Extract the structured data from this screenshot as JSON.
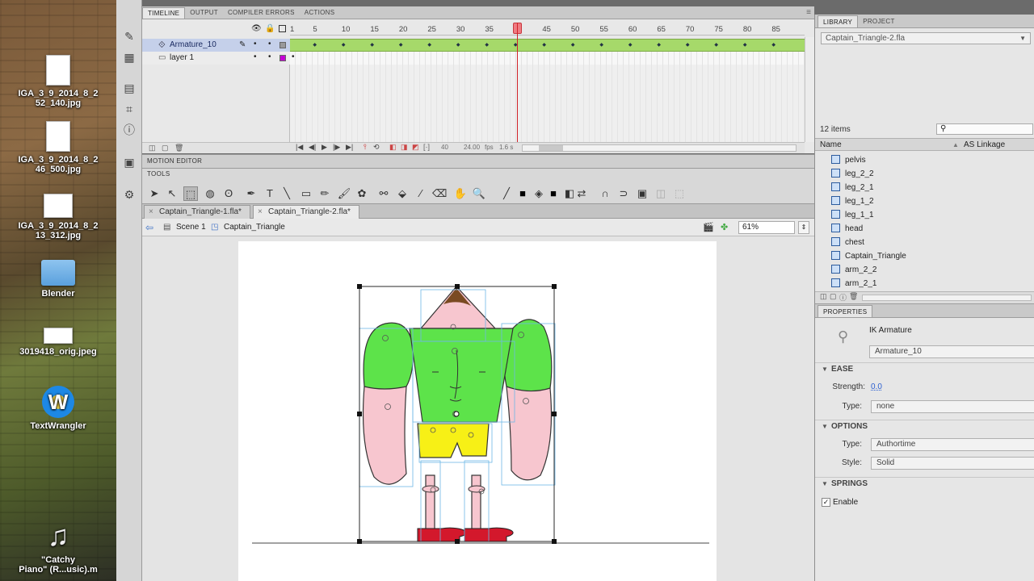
{
  "desktop": {
    "items": [
      {
        "label": "IGA_3_9_2014_8_2\n52_140.jpg"
      },
      {
        "label": "IGA_3_9_2014_8_2\n46_500.jpg"
      },
      {
        "label": "IGA_3_9_2014_8_2\n13_312.jpg"
      },
      {
        "label": "Blender"
      },
      {
        "label": "3019418_orig.jpeg"
      },
      {
        "label": "TextWrangler"
      },
      {
        "label": "\"Catchy\nPiano\" (R...usic).m"
      }
    ]
  },
  "timeline": {
    "tabs": [
      "TIMELINE",
      "OUTPUT",
      "COMPILER ERRORS",
      "ACTIONS"
    ],
    "frame_numbers": [
      "1",
      "5",
      "10",
      "15",
      "20",
      "25",
      "30",
      "35",
      "40",
      "45",
      "50",
      "55",
      "60",
      "65",
      "70",
      "75",
      "80",
      "85"
    ],
    "current_frame": 40,
    "layers": [
      {
        "name": "Armature_10",
        "selected": true
      },
      {
        "name": "layer 1",
        "selected": false
      }
    ],
    "footer": {
      "frame": "40",
      "fps": "24.00",
      "fps_unit": "fps",
      "time": "1.6 s"
    }
  },
  "motion_editor": {
    "label": "MOTION EDITOR"
  },
  "tools": {
    "label": "TOOLS"
  },
  "documents": {
    "tabs": [
      {
        "label": "Captain_Triangle-1.fla*",
        "active": false
      },
      {
        "label": "Captain_Triangle-2.fla*",
        "active": true
      }
    ]
  },
  "editbar": {
    "scene": "Scene 1",
    "symbol": "Captain_Triangle",
    "zoom": "61%"
  },
  "library": {
    "tabs": [
      "LIBRARY",
      "PROJECT"
    ],
    "document": "Captain_Triangle-2.fla",
    "count": "12 items",
    "columns": [
      "Name",
      "AS Linkage"
    ],
    "items": [
      "pelvis",
      "leg_2_2",
      "leg_2_1",
      "leg_1_2",
      "leg_1_1",
      "head",
      "chest",
      "Captain_Triangle",
      "arm_2_2",
      "arm_2_1"
    ]
  },
  "properties": {
    "tab": "PROPERTIES",
    "object_type": "IK Armature",
    "instance_name": "Armature_10",
    "ease": {
      "header": "EASE",
      "strength_label": "Strength:",
      "strength": "0.0",
      "type_label": "Type:",
      "type": "none"
    },
    "options": {
      "header": "OPTIONS",
      "type_label": "Type:",
      "type": "Authortime",
      "style_label": "Style:",
      "style": "Solid"
    },
    "springs": {
      "header": "SPRINGS",
      "enable_label": "Enable",
      "enabled": true
    }
  },
  "colors": {
    "accent": "#5d7fd1",
    "keyframe_green": "#a6d96a",
    "playhead": "#d2232a",
    "character_green": "#5de34a",
    "character_pink": "#f7c6cf",
    "character_yellow": "#f7f016",
    "shoe_red": "#d3182c"
  }
}
